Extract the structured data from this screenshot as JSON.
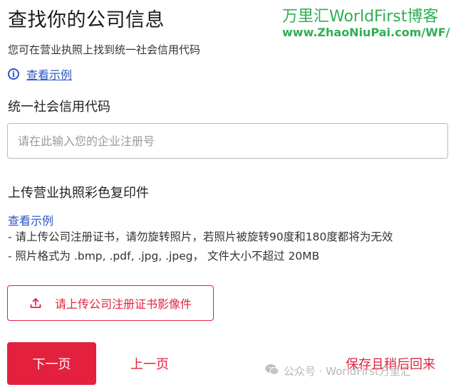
{
  "header": {
    "title": "查找你的公司信息",
    "subtitle": "您可在营业执照上找到统一社会信用代码",
    "example_link": "查看示例"
  },
  "credit_code": {
    "label": "统一社会信用代码",
    "placeholder": "请在此输入您的企业注册号",
    "value": ""
  },
  "upload_section": {
    "title": "上传营业执照彩色复印件",
    "example_link": "查看示例",
    "notes": [
      "- 请上传公司注册证书，请勿旋转照片，若照片被旋转90度和180度都将为无效",
      "- 照片格式为 .bmp, .pdf, .jpg, .jpeg， 文件大小不超过 20MB"
    ],
    "upload_button_label": "请上传公司注册证书影像件"
  },
  "footer": {
    "next_label": "下一页",
    "prev_label": "上一页",
    "save_later_label": "保存且稍后回来"
  },
  "watermark": {
    "title": "万里汇WorldFirst博客",
    "url": "www.ZhaoNiuPai.com/WF/",
    "wechat": "公众号 · WorldFirst万里汇"
  },
  "icons": {
    "info": "info-circle-icon",
    "upload": "upload-icon",
    "wechat": "wechat-icon"
  },
  "colors": {
    "accent": "#e3213f",
    "link": "#2b55c8",
    "watermark": "#2fae55"
  }
}
